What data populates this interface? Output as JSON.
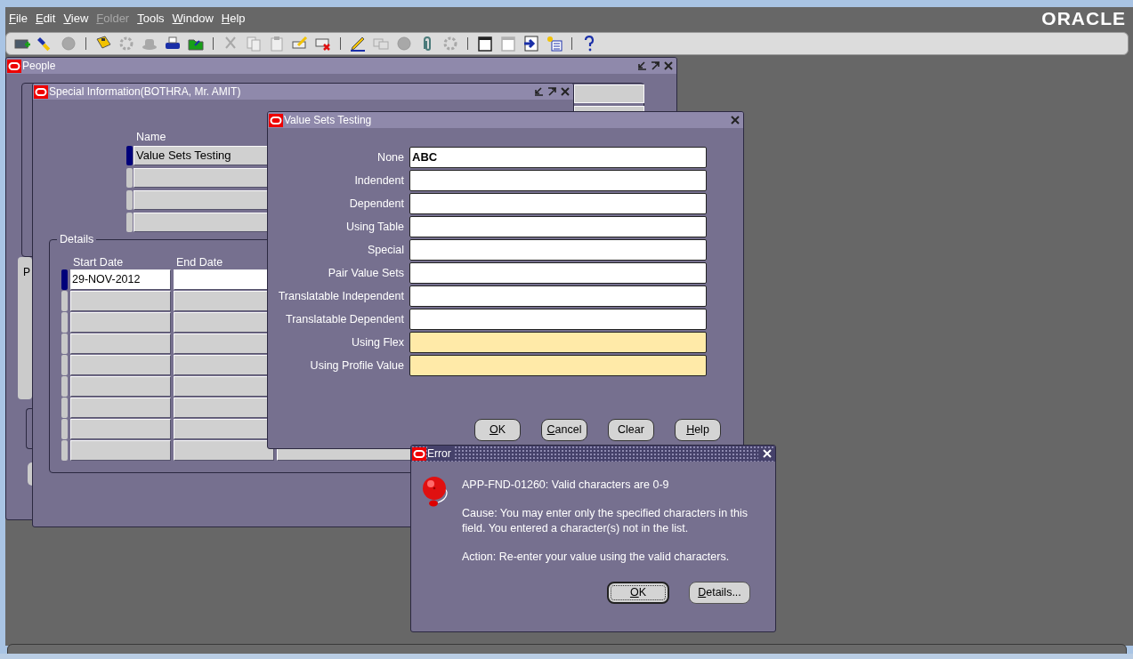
{
  "menu": [
    {
      "label": "File",
      "disabled": false
    },
    {
      "label": "Edit",
      "disabled": false
    },
    {
      "label": "View",
      "disabled": false
    },
    {
      "label": "Folder",
      "disabled": true
    },
    {
      "label": "Tools",
      "disabled": false
    },
    {
      "label": "Window",
      "disabled": false
    },
    {
      "label": "Help",
      "disabled": false
    }
  ],
  "brand": "ORACLE",
  "toolbar": [
    {
      "kind": "new",
      "disabled": false
    },
    {
      "kind": "find",
      "disabled": false
    },
    {
      "kind": "globe",
      "disabled": true
    },
    {
      "kind": "separator"
    },
    {
      "kind": "save",
      "disabled": false
    },
    {
      "kind": "gear",
      "disabled": true
    },
    {
      "kind": "hat",
      "disabled": true
    },
    {
      "kind": "print",
      "disabled": false
    },
    {
      "kind": "folder",
      "disabled": false
    },
    {
      "kind": "separator"
    },
    {
      "kind": "cut",
      "disabled": true
    },
    {
      "kind": "copy",
      "disabled": true
    },
    {
      "kind": "paste",
      "disabled": true
    },
    {
      "kind": "clear",
      "disabled": false
    },
    {
      "kind": "delete",
      "disabled": false
    },
    {
      "kind": "separator"
    },
    {
      "kind": "edit",
      "disabled": false
    },
    {
      "kind": "boxes",
      "disabled": true
    },
    {
      "kind": "globe",
      "disabled": true
    },
    {
      "kind": "clip",
      "disabled": false
    },
    {
      "kind": "gear",
      "disabled": true
    },
    {
      "kind": "separator"
    },
    {
      "kind": "calendar",
      "disabled": false
    },
    {
      "kind": "calendar",
      "disabled": true
    },
    {
      "kind": "window",
      "disabled": false
    },
    {
      "kind": "tasks",
      "disabled": false
    },
    {
      "kind": "separator"
    },
    {
      "kind": "help",
      "disabled": false
    }
  ],
  "people_window": {
    "title": "People",
    "active": false,
    "tab_label": "P"
  },
  "special_window": {
    "title": "Special Information(BOTHRA, Mr. AMIT)",
    "active": false,
    "name_label": "Name",
    "name_rows": [
      {
        "value": "Value Sets Testing",
        "current": true
      },
      {
        "current": false
      },
      {
        "current": false
      },
      {
        "current": false
      }
    ],
    "details": {
      "title": "Details",
      "columns": [
        "Start Date",
        "End Date"
      ],
      "rows": [
        {
          "start_date": "29-NOV-2012",
          "current": true
        },
        {
          "current": false
        },
        {
          "current": false
        },
        {
          "current": false
        },
        {
          "current": false
        },
        {
          "current": false
        },
        {
          "current": false
        },
        {
          "current": false
        },
        {
          "current": false
        }
      ]
    }
  },
  "value_sets_dialog": {
    "title": "Value Sets Testing",
    "active": false,
    "fields": [
      {
        "label": "None",
        "value": "ABC",
        "required": false
      },
      {
        "label": "Indendent",
        "required": false
      },
      {
        "label": "Dependent",
        "required": false
      },
      {
        "label": "Using Table",
        "required": false
      },
      {
        "label": "Special",
        "required": false
      },
      {
        "label": "Pair Value Sets",
        "required": false
      },
      {
        "label": "Translatable Independent",
        "required": false
      },
      {
        "label": "Translatable Dependent",
        "required": false
      },
      {
        "label": "Using Flex",
        "required": true
      },
      {
        "label": "Using Profile Value",
        "required": true
      }
    ],
    "buttons": [
      {
        "label": "OK",
        "mnemonic": true
      },
      {
        "label": "Cancel",
        "mnemonic": true
      },
      {
        "label": "Clear",
        "mnemonic": false
      },
      {
        "label": "Help",
        "mnemonic": true
      }
    ]
  },
  "error_dialog": {
    "title": "Error",
    "active": true,
    "message": "APP-FND-01260: Valid characters are 0-9",
    "cause": "Cause: You may enter only the specified characters in this field. You entered a character(s) not in the list.",
    "action": "Action: Re-enter your value using the valid characters.",
    "buttons": [
      {
        "label": "OK",
        "default": true,
        "mnemonic": true
      },
      {
        "label": "Details...",
        "default": false,
        "mnemonic": true
      }
    ]
  }
}
